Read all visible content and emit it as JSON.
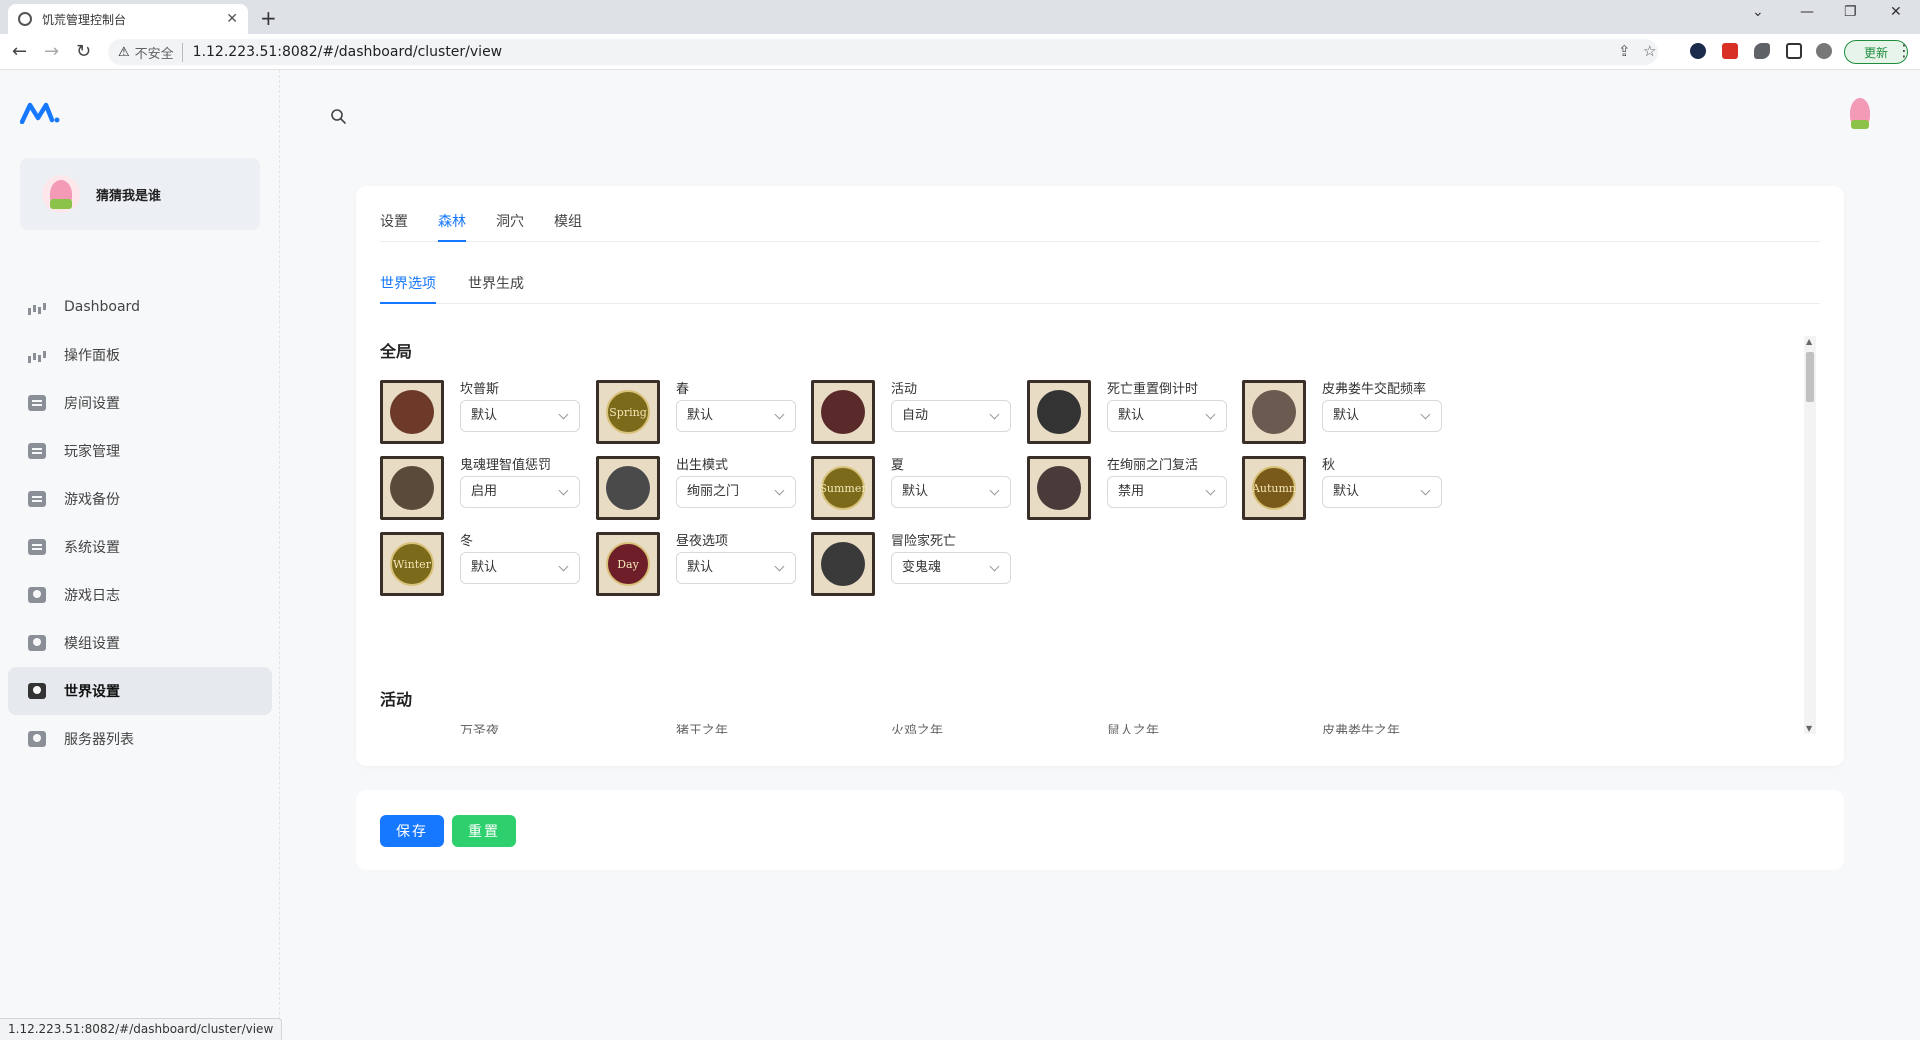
{
  "browser": {
    "tab_title": "饥荒管理控制台",
    "insecure_label": "不安全",
    "url": "1.12.223.51:8082/#/dashboard/cluster/view",
    "update_label": "更新",
    "status_url": "1.12.223.51:8082/#/dashboard/cluster/view"
  },
  "user": {
    "name": "猜猜我是谁"
  },
  "sidebar": {
    "items": [
      {
        "label": "Dashboard",
        "icon": "chart-icon"
      },
      {
        "label": "操作面板",
        "icon": "chart-icon"
      },
      {
        "label": "房间设置",
        "icon": "document-icon"
      },
      {
        "label": "玩家管理",
        "icon": "document-icon"
      },
      {
        "label": "游戏备份",
        "icon": "document-icon"
      },
      {
        "label": "系统设置",
        "icon": "document-icon"
      },
      {
        "label": "游戏日志",
        "icon": "person-icon"
      },
      {
        "label": "模组设置",
        "icon": "person-icon"
      },
      {
        "label": "世界设置",
        "icon": "person-icon",
        "active": true
      },
      {
        "label": "服务器列表",
        "icon": "person-icon"
      }
    ]
  },
  "tabs_main": [
    "设置",
    "森林",
    "洞穴",
    "模组"
  ],
  "tabs_main_active": "森林",
  "tabs_sub": [
    "世界选项",
    "世界生成"
  ],
  "tabs_sub_active": "世界选项",
  "sections": {
    "global_title": "全局",
    "events_title": "活动"
  },
  "options": [
    {
      "label": "坎普斯",
      "value": "默认",
      "icon": "krampus-icon"
    },
    {
      "label": "春",
      "value": "默认",
      "icon": "spring-icon",
      "icon_text": "Spring"
    },
    {
      "label": "活动",
      "value": "自动",
      "icon": "calendar-icon"
    },
    {
      "label": "死亡重置倒计时",
      "value": "默认",
      "icon": "clock-icon"
    },
    {
      "label": "皮弗娄牛交配频率",
      "value": "默认",
      "icon": "beefalo-icon"
    },
    {
      "label": "鬼魂理智值惩罚",
      "value": "启用",
      "icon": "ghost-sanity-icon"
    },
    {
      "label": "出生模式",
      "value": "绚丽之门",
      "icon": "spawn-portal-icon"
    },
    {
      "label": "夏",
      "value": "默认",
      "icon": "summer-icon",
      "icon_text": "Summer"
    },
    {
      "label": "在绚丽之门复活",
      "value": "禁用",
      "icon": "portal-resurrect-icon"
    },
    {
      "label": "秋",
      "value": "默认",
      "icon": "autumn-icon",
      "icon_text": "Autumn"
    },
    {
      "label": "冬",
      "value": "默认",
      "icon": "winter-icon",
      "icon_text": "Winter"
    },
    {
      "label": "昼夜选项",
      "value": "默认",
      "icon": "day-icon",
      "icon_text": "Day"
    },
    {
      "label": "冒险家死亡",
      "value": "变鬼魂",
      "icon": "ghost-icon"
    }
  ],
  "events_partial_labels": [
    "万圣夜",
    "猪王之年",
    "火鸡之年",
    "鼠人之年",
    "皮弗娄牛之年"
  ],
  "actions": {
    "save_label": "保存",
    "reset_label": "重置"
  },
  "colors": {
    "primary": "#1677ff",
    "success": "#2ed06e"
  }
}
